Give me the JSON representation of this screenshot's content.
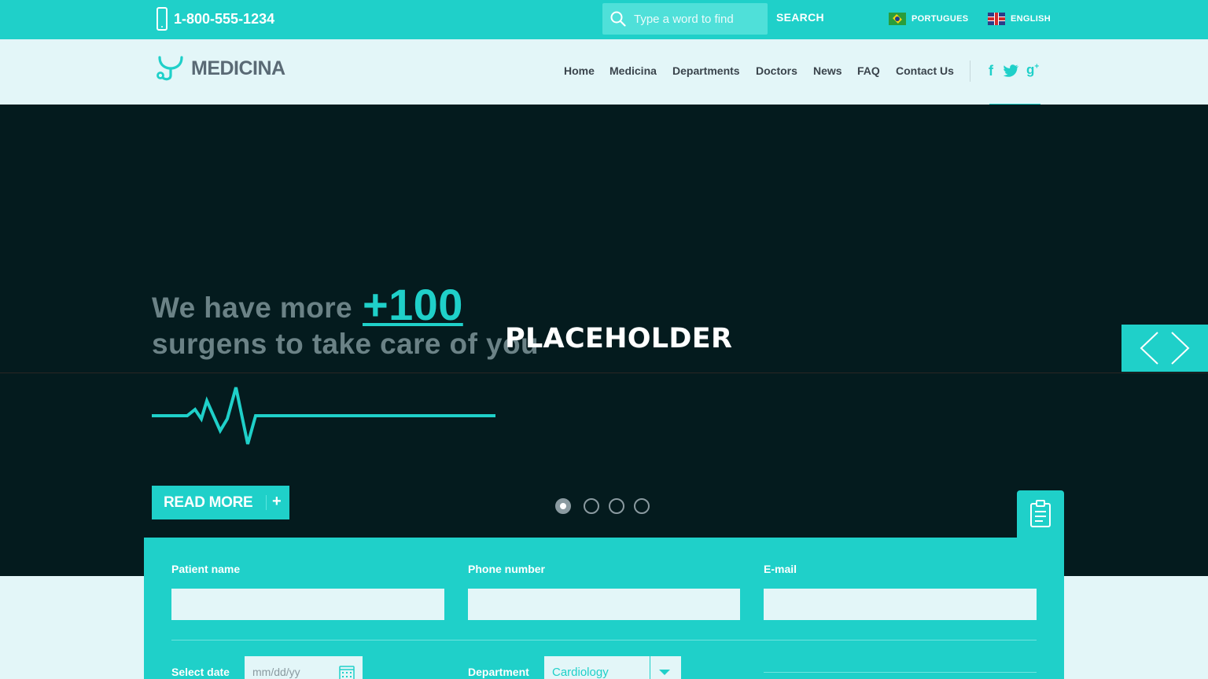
{
  "topbar": {
    "phone": "1-800-555-1234",
    "search_placeholder": "Type a word to find",
    "search_button": "SEARCH",
    "languages": [
      {
        "label": "PORTUGUES",
        "flag": "brazil-flag-icon"
      },
      {
        "label": "ENGLISH",
        "flag": "uk-flag-icon"
      }
    ]
  },
  "nav": {
    "logo": "MEDICINA",
    "items": [
      "Home",
      "Medicina",
      "Departments",
      "Doctors",
      "News",
      "FAQ",
      "Contact Us"
    ],
    "social": [
      "facebook-icon",
      "twitter-icon",
      "google-plus-icon"
    ]
  },
  "hero": {
    "line1": "We have more",
    "number": "+100",
    "line2": "surgens to take care of you",
    "overlay": "PLACEHOLDER",
    "read_more": "READ MORE",
    "read_more_icon": "+",
    "slides": 4,
    "active_slide": 1
  },
  "form": {
    "patient_label": "Patient name",
    "phone_label": "Phone number",
    "email_label": "E-mail",
    "date_label": "Select date",
    "date_placeholder": "mm/dd/yy",
    "department_label": "Department",
    "department_value": "Cardiology"
  },
  "colors": {
    "accent": "#1fd0c9",
    "hero_bg": "#041b1e",
    "nav_bg": "#e3f6f8",
    "text_dark": "#3a444c"
  }
}
